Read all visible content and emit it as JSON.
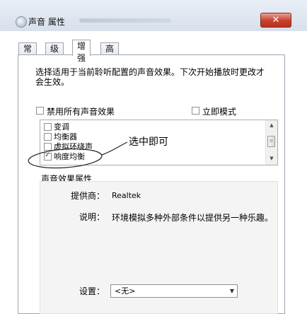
{
  "window": {
    "title": "声音 属性",
    "close_glyph": "✕"
  },
  "tabs": [
    {
      "label": "常规"
    },
    {
      "label": "级别"
    },
    {
      "label": "增强"
    },
    {
      "label": "高级"
    }
  ],
  "description": "选择适用于当前聆听配置的声音效果。下次开始播放时更改才会生效。",
  "disable_all": {
    "label": "禁用所有声音效果",
    "checked": false
  },
  "immediate_mode": {
    "label": "立即模式",
    "checked": false
  },
  "effects": [
    {
      "label": "变调",
      "checked": false
    },
    {
      "label": "均衡器",
      "checked": false
    },
    {
      "label": "虚拟环绕声",
      "checked": false
    },
    {
      "label": "响度均衡",
      "checked": true
    }
  ],
  "annotation": "选中即可",
  "properties": {
    "group_title": "声音效果属性",
    "provider_label": "提供商：",
    "provider_value": "Realtek",
    "desc_label": "说明：",
    "desc_value": "环境模拟多种外部条件以提供另一种乐趣。",
    "setting_label": "设置：",
    "setting_value": "<无>"
  },
  "icons": {
    "scroll_up": "▲",
    "scroll_down": "▼",
    "thumb_grip": "≡",
    "dropdown": "▼"
  },
  "colors": {
    "close_button": "#c6402c",
    "checkmark": "#2b4d80"
  }
}
